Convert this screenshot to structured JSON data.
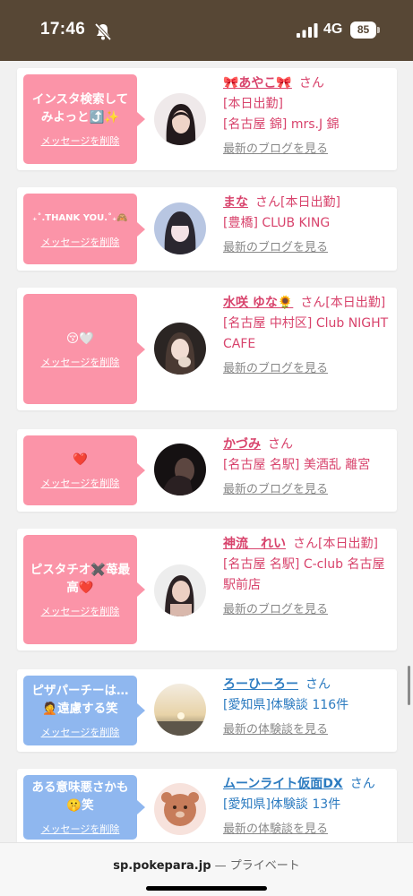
{
  "status": {
    "time": "17:46",
    "network": "4G",
    "battery": "85",
    "silent_icon": "bell-slash-icon",
    "signal_icon": "signal-bars-icon"
  },
  "delete_label": "メッセージを削除",
  "cards": [
    {
      "message": "インスタ検索してみよっと⤴️✨",
      "name": "🎀あやこ🎀",
      "san": "さん",
      "line1": "[本日出勤]",
      "line2": "[名古屋 錦] mrs.J 錦",
      "link": "最新のブログを見る"
    },
    {
      "message": "₊˚.THANK YOU.˚₊🙈",
      "name": "まな",
      "san": "さん[本日出勤]",
      "line1": "[豊橋] CLUB KING",
      "link": "最新のブログを見る"
    },
    {
      "message": "😚🤍",
      "name": "水咲 ゆな🌻",
      "san": "さん[本日出勤]",
      "line1": "[名古屋 中村区] Club NIGHT CAFE",
      "link": "最新のブログを見る"
    },
    {
      "message": "❤️",
      "name": "かづみ",
      "san": "さん",
      "line1": "[名古屋 名駅] 美酒乱 離宮",
      "link": "最新のブログを見る"
    },
    {
      "message": "ピスタチオ✖️苺最高❤️",
      "name": "神流　れい",
      "san": "さん[本日出勤]",
      "line1": "[名古屋 名駅] C-club 名古屋駅前店",
      "link": "最新のブログを見る"
    },
    {
      "message": "ピザパーチーは…🤦遠慮する笑",
      "name": "ろーひーろー",
      "san": "さん",
      "line1": "[愛知県]体験談 116件",
      "link": "最新の体験談を見る"
    },
    {
      "message": "ある意味悪さかも🤫笑",
      "name": "ムーンライト仮面DX",
      "san": "さん",
      "line1": "[愛知県]体験談 13件",
      "link": "最新の体験談を見る"
    }
  ],
  "browser": {
    "host": "sp.pokepara.jp",
    "separator": "—",
    "mode": "プライベート"
  },
  "colors": {
    "status_bar": "#574735",
    "pink_bubble": "#fb94a8",
    "blue_bubble": "#8fb7ef",
    "pink_text": "#d8436c",
    "blue_text": "#2c7bc0",
    "link_gray": "#888888"
  }
}
